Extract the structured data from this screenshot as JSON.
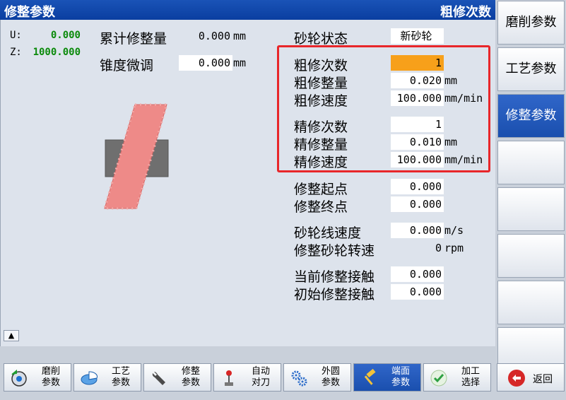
{
  "title": {
    "left": "修整参数",
    "right": "粗修次数"
  },
  "axes": [
    {
      "label": "U:",
      "value": "0.000"
    },
    {
      "label": "Z:",
      "value": "1000.000"
    }
  ],
  "left_params": {
    "cumulative_label": "累计修整量",
    "cumulative_value": "0.000",
    "cumulative_unit": "mm",
    "taper_label": "锥度微调",
    "taper_value": "0.000",
    "taper_unit": "mm"
  },
  "wheel_state": {
    "label": "砂轮状态",
    "value": "新砂轮"
  },
  "rough": {
    "count_label": "粗修次数",
    "count_value": "1",
    "amount_label": "粗修整量",
    "amount_value": "0.020",
    "amount_unit": "mm",
    "speed_label": "粗修速度",
    "speed_value": "100.000",
    "speed_unit": "mm/min"
  },
  "fine": {
    "count_label": "精修次数",
    "count_value": "1",
    "amount_label": "精修整量",
    "amount_value": "0.010",
    "amount_unit": "mm",
    "speed_label": "精修速度",
    "speed_value": "100.000",
    "speed_unit": "mm/min"
  },
  "positions": {
    "start_label": "修整起点",
    "start_value": "0.000",
    "end_label": "修整终点",
    "end_value": "0.000"
  },
  "speeds": {
    "linear_label": "砂轮线速度",
    "linear_value": "0.000",
    "linear_unit": "m/s",
    "rpm_label": "修整砂轮转速",
    "rpm_value": "0",
    "rpm_unit": "rpm"
  },
  "contact": {
    "current_label": "当前修整接触",
    "current_value": "0.000",
    "initial_label": "初始修整接触",
    "initial_value": "0.000"
  },
  "right_softkeys": [
    "磨削参数",
    "工艺参数",
    "修整参数",
    "",
    "",
    "",
    "",
    ""
  ],
  "right_active_index": 2,
  "bottom_softkeys": [
    {
      "line1": "磨削",
      "line2": "参数",
      "icon": "grinding-icon"
    },
    {
      "line1": "工艺",
      "line2": "参数",
      "icon": "pie-icon"
    },
    {
      "line1": "修整",
      "line2": "参数",
      "icon": "wrench-icon"
    },
    {
      "line1": "自动",
      "line2": "对刀",
      "icon": "probe-icon"
    },
    {
      "line1": "外圆",
      "line2": "参数",
      "icon": "gears-icon"
    },
    {
      "line1": "端面",
      "line2": "参数",
      "icon": "hammer-icon"
    },
    {
      "line1": "加工",
      "line2": "选择",
      "icon": "check-icon"
    }
  ],
  "bottom_active_index": 5,
  "back_label": "返回",
  "colors": {
    "title_bar": "#0a3ea0",
    "highlight_field": "#f7a01a",
    "axis_value": "#0b8a0b",
    "frame": "#e8262a",
    "wheel": "#ee8a88"
  }
}
